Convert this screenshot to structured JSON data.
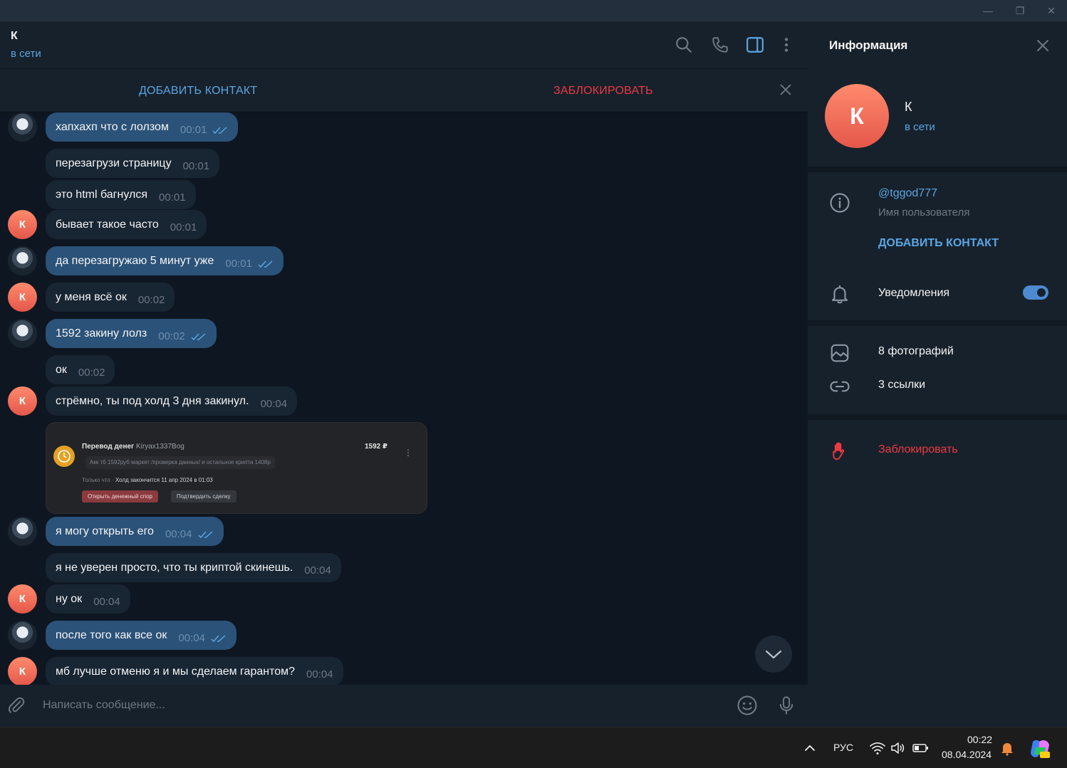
{
  "window": {
    "minimize": "—",
    "restore": "❐",
    "close": "✕"
  },
  "chat": {
    "name": "К",
    "status": "в сети"
  },
  "actions": {
    "add_contact": "ДОБАВИТЬ КОНТАКТ",
    "block": "ЗАБЛОКИРОВАТЬ"
  },
  "messages": [
    {
      "text": "хапхахп что с лолзом",
      "time": "00:01",
      "dir": "out",
      "avatar": "img"
    },
    {
      "text": "перезагрузи страницу",
      "time": "00:01",
      "dir": "in",
      "avatar": ""
    },
    {
      "text": "это html багнулся",
      "time": "00:01",
      "dir": "in",
      "avatar": ""
    },
    {
      "text": "бывает такое часто",
      "time": "00:01",
      "dir": "in",
      "avatar": "К"
    },
    {
      "text": "да перезагружаю 5 минут уже",
      "time": "00:01",
      "dir": "out",
      "avatar": "img"
    },
    {
      "text": "у меня всё ок",
      "time": "00:02",
      "dir": "in",
      "avatar": "К"
    },
    {
      "text": "1592 закину лолз",
      "time": "00:02",
      "dir": "out",
      "avatar": "img"
    },
    {
      "text": "ок",
      "time": "00:02",
      "dir": "in",
      "avatar": ""
    },
    {
      "text": "стрёмно, ты под холд 3 дня закинул.",
      "time": "00:04",
      "dir": "in",
      "avatar": "К"
    },
    {
      "text": "я могу открыть его",
      "time": "00:04",
      "dir": "out",
      "avatar": "img"
    },
    {
      "text": "я не уверен просто, что ты криптой скинешь.",
      "time": "00:04",
      "dir": "in",
      "avatar": ""
    },
    {
      "text": "ну ок",
      "time": "00:04",
      "dir": "in",
      "avatar": "К"
    },
    {
      "text": "после того как все ок",
      "time": "00:04",
      "dir": "out",
      "avatar": "img"
    },
    {
      "text": "мб лучше отменю я и мы сделаем гарантом?",
      "time": "00:04",
      "dir": "in",
      "avatar": "К"
    }
  ],
  "media": {
    "title": "Перевод денег",
    "user": "Kiryax1337Bog",
    "amount": "1592 ₽",
    "desc": "Акк тб 1592руб маркет /проверка данных/ и остальное крипта 1408р",
    "when": "Только что",
    "hold": "Холд закончится 11 апр 2024 в 01:03",
    "btn_dispute": "Открыть денежный спор",
    "btn_confirm": "Подтвердить сделку"
  },
  "composer": {
    "placeholder": "Написать сообщение..."
  },
  "info": {
    "title": "Информация",
    "name": "К",
    "status": "в сети",
    "username": "@tggod777",
    "username_label": "Имя пользователя",
    "add_contact": "ДОБАВИТЬ КОНТАКТ",
    "notifications": "Уведомления",
    "notifications_on": true,
    "photos": "8 фотографий",
    "links": "3 ссылки",
    "block": "Заблокировать"
  },
  "taskbar": {
    "lang": "РУС",
    "time": "00:22",
    "date": "08.04.2024"
  },
  "colors": {
    "accent": "#5aa5e3",
    "danger": "#ec3942",
    "bubble_out": "#2b5278",
    "bubble_in": "#182533",
    "bg": "#0e1621"
  }
}
